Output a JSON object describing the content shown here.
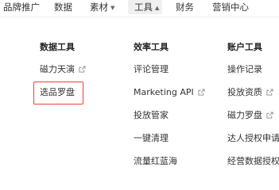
{
  "topnav": {
    "items": [
      {
        "label": "品牌推广"
      },
      {
        "label": "数据"
      },
      {
        "label": "素材"
      },
      {
        "label": "工具"
      },
      {
        "label": "财务"
      },
      {
        "label": "营销中心"
      }
    ],
    "active_item": "工具",
    "caret_down_icon": "chevron-down-icon",
    "caret_up_icon": "chevron-up-icon"
  },
  "dropdown": {
    "columns": [
      {
        "heading": "数据工具",
        "items": [
          {
            "label": "磁力天演",
            "external": true
          },
          {
            "label": "选品罗盘",
            "external": false,
            "highlighted": true
          }
        ]
      },
      {
        "heading": "效率工具",
        "items": [
          {
            "label": "评论管理",
            "external": false
          },
          {
            "label": "Marketing API",
            "external": true
          },
          {
            "label": "投放管家",
            "external": false
          },
          {
            "label": "一键清理",
            "external": false
          },
          {
            "label": "流量红蓝海",
            "external": false
          }
        ]
      },
      {
        "heading": "账户工具",
        "items": [
          {
            "label": "操作记录",
            "external": false
          },
          {
            "label": "投放资质",
            "external": true
          },
          {
            "label": "磁力罗盘",
            "external": true
          },
          {
            "label": "达人授权申请",
            "external": false
          },
          {
            "label": "经营数据授权",
            "external": false
          }
        ]
      }
    ],
    "external_link_icon": "external-link-icon",
    "highlight_color": "#e8412c"
  }
}
